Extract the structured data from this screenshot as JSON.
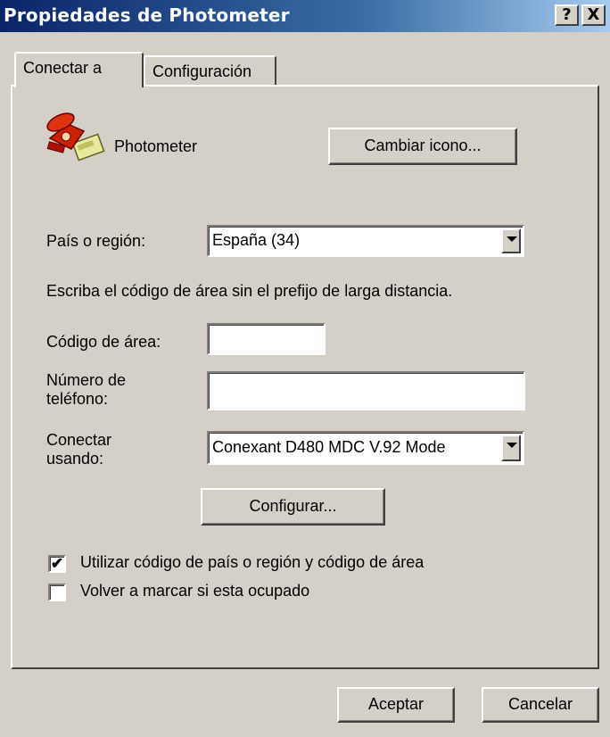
{
  "window": {
    "title": "Propiedades de Photometer",
    "help_glyph": "?",
    "close_glyph": "X"
  },
  "tabs": [
    {
      "label": "Conectar a"
    },
    {
      "label": "Configuración"
    }
  ],
  "connection": {
    "icon": "telephone-icon",
    "name": "Photometer",
    "change_icon_label": "Cambiar icono..."
  },
  "country": {
    "label": "País o región:",
    "value": "España (34)"
  },
  "area_hint": "Escriba el código de área sin el prefijo de larga distancia.",
  "area_code": {
    "label": "Código de área:",
    "value": ""
  },
  "phone": {
    "label_line1": "Número de",
    "label_line2": "teléfono:",
    "value": ""
  },
  "connect_using": {
    "label_line1": "Conectar",
    "label_line2": "usando:",
    "value": "Conexant D480 MDC V.92 Mode"
  },
  "configure_label": "Configurar...",
  "options": [
    {
      "label": "Utilizar código de país o región y código de área",
      "checked": true,
      "mark": "✔"
    },
    {
      "label": "Volver a marcar si esta ocupado",
      "checked": false,
      "mark": ""
    }
  ],
  "footer": {
    "ok_label": "Aceptar",
    "cancel_label": "Cancelar"
  }
}
